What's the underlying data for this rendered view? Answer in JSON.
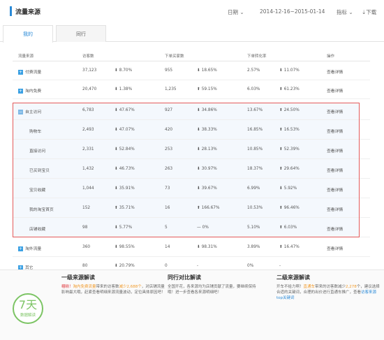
{
  "header": {
    "title": "流量来源",
    "date_label": "日期",
    "date_range": "2014-12-16~2015-01-14",
    "metric_label": "指标",
    "download_label": "下载"
  },
  "tabs": [
    {
      "label": "我的"
    },
    {
      "label": "同行"
    }
  ],
  "columns": {
    "source": "流量来源",
    "visitors": "访客数",
    "orders": "下单买家数",
    "conversion": "下单转化率",
    "action": "操作"
  },
  "rows": [
    {
      "name": "付费流量",
      "visitors": "37,123",
      "v_change": "8.70%",
      "v_dir": "down",
      "orders": "955",
      "o_change": "18.65%",
      "o_dir": "down",
      "conv": "2.57%",
      "c_change": "11.07%",
      "c_dir": "down",
      "action": "查看详情",
      "expand": "+"
    },
    {
      "name": "淘内免费",
      "visitors": "20,470",
      "v_change": "1.38%",
      "v_dir": "down",
      "orders": "1,235",
      "o_change": "59.15%",
      "o_dir": "up",
      "conv": "6.03%",
      "c_change": "61.23%",
      "c_dir": "up",
      "action": "查看详情",
      "expand": "+"
    },
    {
      "name": "自主访问",
      "visitors": "6,783",
      "v_change": "47.67%",
      "v_dir": "down",
      "orders": "927",
      "o_change": "34.86%",
      "o_dir": "down",
      "conv": "13.67%",
      "c_change": "24.50%",
      "c_dir": "up",
      "action": "查看详情",
      "expand": "−"
    },
    {
      "name": "购物车",
      "visitors": "2,493",
      "v_change": "47.07%",
      "v_dir": "down",
      "orders": "420",
      "o_change": "38.33%",
      "o_dir": "down",
      "conv": "16.85%",
      "c_change": "16.53%",
      "c_dir": "up",
      "action": "查看详情"
    },
    {
      "name": "直接访问",
      "visitors": "2,331",
      "v_change": "52.84%",
      "v_dir": "down",
      "orders": "253",
      "o_change": "28.13%",
      "o_dir": "down",
      "conv": "10.85%",
      "c_change": "52.39%",
      "c_dir": "up",
      "action": "查看详情"
    },
    {
      "name": "已买到宝贝",
      "visitors": "1,432",
      "v_change": "46.73%",
      "v_dir": "down",
      "orders": "263",
      "o_change": "30.97%",
      "o_dir": "down",
      "conv": "18.37%",
      "c_change": "29.64%",
      "c_dir": "up",
      "action": "查看详情"
    },
    {
      "name": "宝贝收藏",
      "visitors": "1,044",
      "v_change": "35.91%",
      "v_dir": "down",
      "orders": "73",
      "o_change": "39.67%",
      "o_dir": "down",
      "conv": "6.99%",
      "c_change": "5.92%",
      "c_dir": "down",
      "action": "查看详情"
    },
    {
      "name": "我的淘宝首页",
      "visitors": "152",
      "v_change": "35.71%",
      "v_dir": "up",
      "orders": "16",
      "o_change": "166.67%",
      "o_dir": "up",
      "conv": "10.53%",
      "c_change": "96.46%",
      "c_dir": "up",
      "action": "查看详情"
    },
    {
      "name": "店铺收藏",
      "visitors": "98",
      "v_change": "5.77%",
      "v_dir": "down",
      "orders": "5",
      "o_change": "0%",
      "o_dir": "flat",
      "conv": "5.10%",
      "c_change": "6.03%",
      "c_dir": "up",
      "action": "查看详情"
    },
    {
      "name": "淘外流量",
      "visitors": "360",
      "v_change": "98.55%",
      "v_dir": "down",
      "orders": "14",
      "o_change": "98.31%",
      "o_dir": "down",
      "conv": "3.89%",
      "c_change": "16.47%",
      "c_dir": "up",
      "action": "查看详情",
      "expand": "+"
    },
    {
      "name": "其它",
      "visitors": "80",
      "v_change": "20.79%",
      "v_dir": "down",
      "orders": "0",
      "o_change": "-",
      "o_dir": "none",
      "conv": "0%",
      "c_change": "-",
      "c_dir": "none",
      "action": "",
      "expand": "+"
    }
  ],
  "bottom": {
    "badge_number": "7天",
    "badge_text": "数据解读",
    "panel1": {
      "title": "一级来源解读",
      "line1": "糟糕！",
      "hl1": "淘内免费流量",
      "line2": "带来的访客数",
      "hl2": "减少2,688个",
      "line3": "，对店铺流量影响最大哦，赶紧查看明细来源流量波动，定位具体原因吧！"
    },
    "panel2": {
      "title": "同行对比解读",
      "text": "全国开花，各来源均为店铺贡献了流量，要继续保持哦！进一步查看各来源明细吧！"
    },
    "panel3": {
      "title": "二级来源解读",
      "line1": "开车不给力啊！",
      "hl1": "直通车",
      "line2": "带来的访客数减少",
      "hl2": "2,278",
      "line3": "个，建议选择合适的关键词，合理的出价进行直通车推广，查看",
      "link": "访客来源top关键词"
    }
  },
  "colors": {
    "accent": "#2a8ad7",
    "up": "#e0454a",
    "down": "#4db36f",
    "highlight_border": "#e45a5a",
    "badge": "#7cc464"
  }
}
